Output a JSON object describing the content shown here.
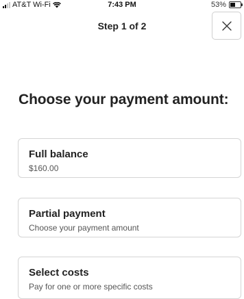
{
  "status_bar": {
    "carrier": "AT&T Wi-Fi",
    "time": "7:43 PM",
    "battery_percent": "53%",
    "battery_level": 0.53,
    "icons": [
      "signal-icon",
      "wifi-icon",
      "battery-icon"
    ]
  },
  "header": {
    "step_label": "Step 1 of 2",
    "close_icon": "close-icon"
  },
  "main": {
    "title": "Choose your payment amount:",
    "options": [
      {
        "title": "Full balance",
        "subtitle": "$160.00"
      },
      {
        "title": "Partial payment",
        "subtitle": "Choose your payment amount"
      },
      {
        "title": "Select costs",
        "subtitle": "Pay for one or more specific costs"
      }
    ]
  }
}
